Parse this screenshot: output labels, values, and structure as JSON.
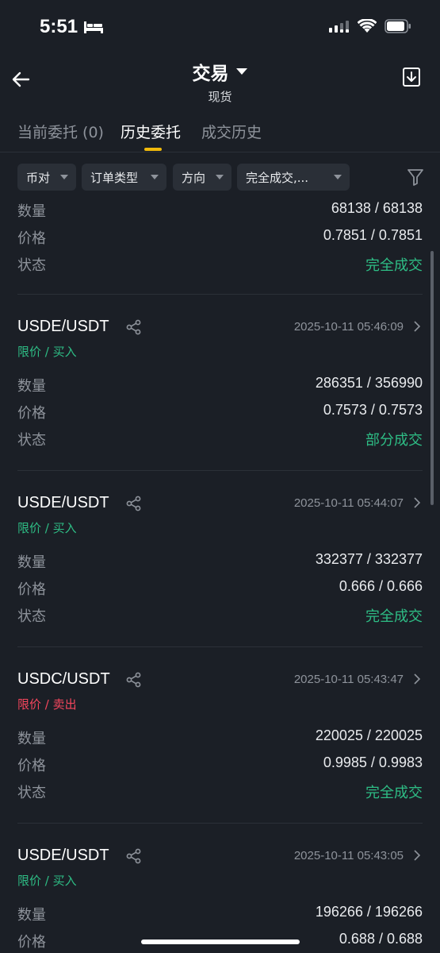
{
  "status_bar": {
    "time": "5:51"
  },
  "nav": {
    "title": "交易",
    "subtitle": "现货"
  },
  "tabs": [
    {
      "label": "当前委托 (0)"
    },
    {
      "label": "历史委托"
    },
    {
      "label": "成交历史"
    }
  ],
  "filters": [
    {
      "label": "币对"
    },
    {
      "label": "订单类型"
    },
    {
      "label": "方向"
    },
    {
      "label": "完全成交,..."
    }
  ],
  "labels": {
    "quantity": "数量",
    "price": "价格",
    "status": "状态"
  },
  "first_order": {
    "quantity": "68138 / 68138",
    "price": "0.7851 / 0.7851",
    "status": "完全成交"
  },
  "orders": [
    {
      "pair": "USDE/USDT",
      "time": "2025-10-11 05:46:09",
      "type": "限价 / 买入",
      "side": "buy",
      "quantity": "286351 / 356990",
      "price": "0.7573 / 0.7573",
      "status": "部分成交"
    },
    {
      "pair": "USDE/USDT",
      "time": "2025-10-11 05:44:07",
      "type": "限价 / 买入",
      "side": "buy",
      "quantity": "332377 / 332377",
      "price": "0.666 / 0.666",
      "status": "完全成交"
    },
    {
      "pair": "USDC/USDT",
      "time": "2025-10-11 05:43:47",
      "type": "限价 / 卖出",
      "side": "sell",
      "quantity": "220025 / 220025",
      "price": "0.9985 / 0.9983",
      "status": "完全成交"
    },
    {
      "pair": "USDE/USDT",
      "time": "2025-10-11 05:43:05",
      "type": "限价 / 买入",
      "side": "buy",
      "quantity": "196266 / 196266",
      "price": "0.688 / 0.688",
      "status": ""
    }
  ],
  "colors": {
    "buy": "#2ebd85",
    "sell": "#f6465d",
    "accent": "#f0b90b",
    "background": "#1b1f26"
  }
}
